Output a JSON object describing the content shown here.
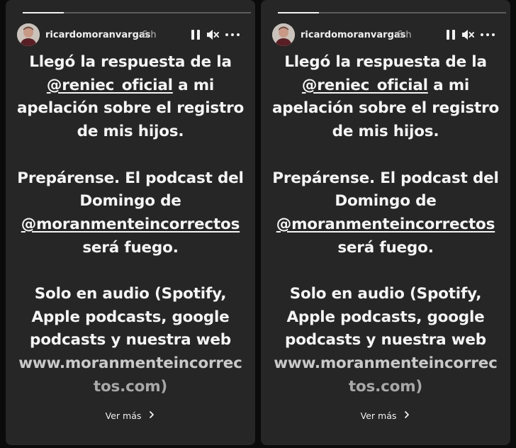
{
  "stories": [
    {
      "username": "ricardomoranvargas",
      "time": "6 h",
      "progress_fraction": 0.18,
      "lines": {
        "p1a": "Llegó la respuesta de la",
        "p1b_mention": "@reniec_oficial",
        "p1b_rest": " a mi",
        "p1c": "apelación sobre el registro",
        "p1d": "de mis hijos.",
        "p2a": "Prepárense. El podcast del",
        "p2b": "Domingo de",
        "p2c_mention": "@moranmenteincorrectos",
        "p2d": "será fuego.",
        "p3a": "Solo en audio (Spotify,",
        "p3b": "Apple podcasts, google",
        "p3c": "podcasts y nuestra web",
        "p3d": "www.moranmenteincorrec",
        "p3e": "tos.com)"
      },
      "see_more": "Ver más"
    },
    {
      "username": "ricardomoranvargas",
      "time": "6 h",
      "progress_fraction": 0.18,
      "lines": {
        "p1a": "Llegó la respuesta de la",
        "p1b_mention": "@reniec_oficial",
        "p1b_rest": " a mi",
        "p1c": "apelación sobre el registro",
        "p1d": "de mis hijos.",
        "p2a": "Prepárense. El podcast del",
        "p2b": "Domingo de",
        "p2c_mention": "@moranmenteincorrectos",
        "p2d": "será fuego.",
        "p3a": "Solo en audio (Spotify,",
        "p3b": "Apple podcasts, google",
        "p3c": "podcasts y nuestra web",
        "p3d": "www.moranmenteincorrec",
        "p3e": "tos.com)"
      },
      "see_more": "Ver más"
    }
  ],
  "icons": {
    "pause": "pause-icon",
    "mute": "speaker-muted-icon",
    "more": "more-options-icon",
    "chevron": "chevron-right-icon"
  },
  "colors": {
    "card_bg": "#262626",
    "page_bg": "#0b0b0b",
    "text": "#f5f5f5"
  }
}
